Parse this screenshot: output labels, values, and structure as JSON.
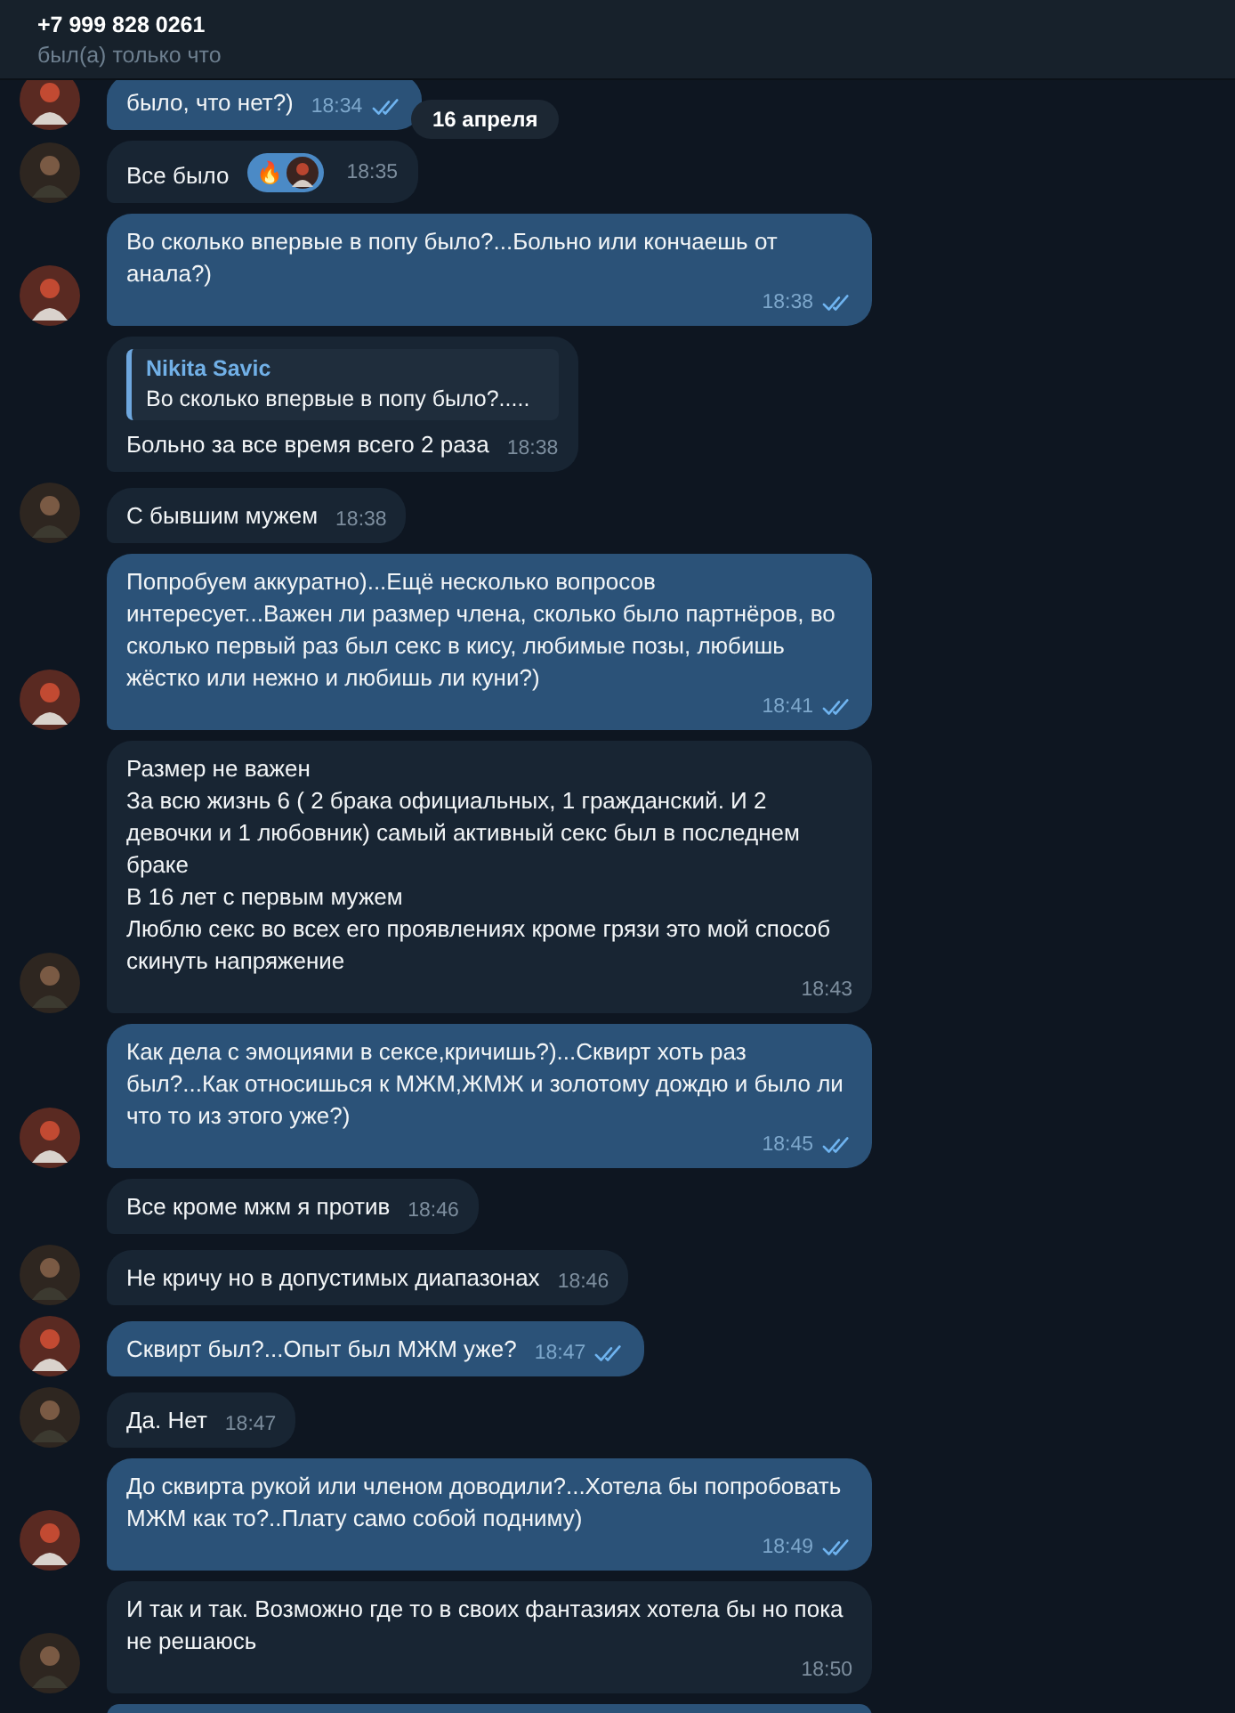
{
  "header": {
    "title": "+7 999 828 0261",
    "status": "был(а) только что"
  },
  "date_badge": "16 апреля",
  "messages": [
    {
      "outgoing": true,
      "avatar": true,
      "text": "было, что нет?)",
      "time": "18:34",
      "read": true
    },
    {
      "outgoing": false,
      "avatar": true,
      "text": "Все было",
      "time": "18:35",
      "reaction": "🔥"
    },
    {
      "outgoing": true,
      "avatar": true,
      "text": "Во сколько впервые в попу было?...Больно или кончаешь от анала?)",
      "time": "18:38",
      "read": true
    },
    {
      "outgoing": false,
      "avatar": false,
      "reply": {
        "author": "Nikita Savic",
        "text": "Во сколько впервые в попу было?....."
      },
      "text": "Больно за все время всего 2 раза",
      "time": "18:38"
    },
    {
      "outgoing": false,
      "avatar": true,
      "text": "С бывшим мужем",
      "time": "18:38"
    },
    {
      "outgoing": true,
      "avatar": true,
      "text": "Попробуем аккуратно)...Ещё несколько вопросов интересует...Важен ли размер члена, сколько было партнёров, во сколько первый раз был секс в кису, любимые позы, любишь жёстко или нежно и любишь ли куни?)",
      "time": "18:41",
      "read": true
    },
    {
      "outgoing": false,
      "avatar": true,
      "text": "Размер не важен\nЗа всю жизнь 6 ( 2 брака официальных, 1 гражданский. И 2 девочки и 1 любовник) самый активный секс был в последнем браке\nВ 16 лет с первым мужем\nЛюблю секс во всех его проявлениях кроме грязи это мой способ скинуть напряжение",
      "time": "18:43"
    },
    {
      "outgoing": true,
      "avatar": true,
      "text": "Как дела с эмоциями в сексе,кричишь?)...Сквирт хоть раз был?...Как относишься к МЖМ,ЖМЖ и золотому дождю и было ли что то из этого уже?)",
      "time": "18:45",
      "read": true
    },
    {
      "outgoing": false,
      "avatar": false,
      "text": "Все кроме мжм я против",
      "time": "18:46"
    },
    {
      "outgoing": false,
      "avatar": true,
      "text": "Не кричу но в допустимых диапазонах",
      "time": "18:46"
    },
    {
      "outgoing": true,
      "avatar": true,
      "text": "Сквирт был?...Опыт был МЖМ уже?",
      "time": "18:47",
      "read": true
    },
    {
      "outgoing": false,
      "avatar": true,
      "text": "Да. Нет",
      "time": "18:47"
    },
    {
      "outgoing": true,
      "avatar": true,
      "text": "До сквирта рукой или членом доводили?...Хотела бы попробовать МЖМ как то?..Плату само собой подниму)",
      "time": "18:49",
      "read": true
    },
    {
      "outgoing": false,
      "avatar": true,
      "text": "И так и так. Возможно где то в своих фантазиях хотела бы но пока не решаюсь",
      "time": "18:50"
    }
  ]
}
